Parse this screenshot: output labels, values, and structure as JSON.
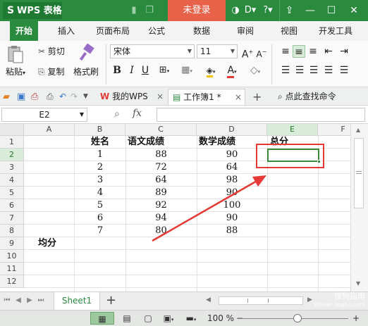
{
  "title_bar": {
    "app_name": "WPS 表格",
    "login_label": "未登录",
    "colors": {
      "bar": "#2a8a3e",
      "login": "#e8624a"
    }
  },
  "menu": {
    "tabs": [
      "开始",
      "插入",
      "页面布局",
      "公式",
      "数据",
      "审阅",
      "视图",
      "开发工具"
    ],
    "active": "开始"
  },
  "ribbon": {
    "cut": "剪切",
    "paste": "粘贴",
    "copy": "复制",
    "format_painter": "格式刷",
    "font_name": "宋体",
    "font_size": "11"
  },
  "doc_tabs": {
    "my_wps": "我的WPS",
    "workbook": "工作簿1 *",
    "search_cmd": "点此查找命令"
  },
  "formula_bar": {
    "name_box": "E2",
    "fx": "fx",
    "value": ""
  },
  "grid": {
    "columns": [
      "A",
      "B",
      "C",
      "D",
      "E",
      "F"
    ],
    "rows": [
      "1",
      "2",
      "3",
      "4",
      "5",
      "6",
      "7",
      "8",
      "9",
      "10",
      "11",
      "12"
    ],
    "headers": {
      "b1": "姓名",
      "c1": "语文成绩",
      "d1": "数学成绩",
      "e1": "总分"
    },
    "data": [
      [
        "1",
        "88",
        "90"
      ],
      [
        "2",
        "72",
        "64"
      ],
      [
        "3",
        "64",
        "98"
      ],
      [
        "4",
        "89",
        "90"
      ],
      [
        "5",
        "92",
        "100"
      ],
      [
        "6",
        "94",
        "90"
      ],
      [
        "7",
        "80",
        "88"
      ]
    ],
    "a9": "均分"
  },
  "sheets": {
    "tabs": [
      "Sheet1"
    ]
  },
  "status_bar": {
    "zoom": "100 %"
  },
  "watermark": {
    "line1": "搜狗指南",
    "line2": "zhinan.sogou.com"
  }
}
